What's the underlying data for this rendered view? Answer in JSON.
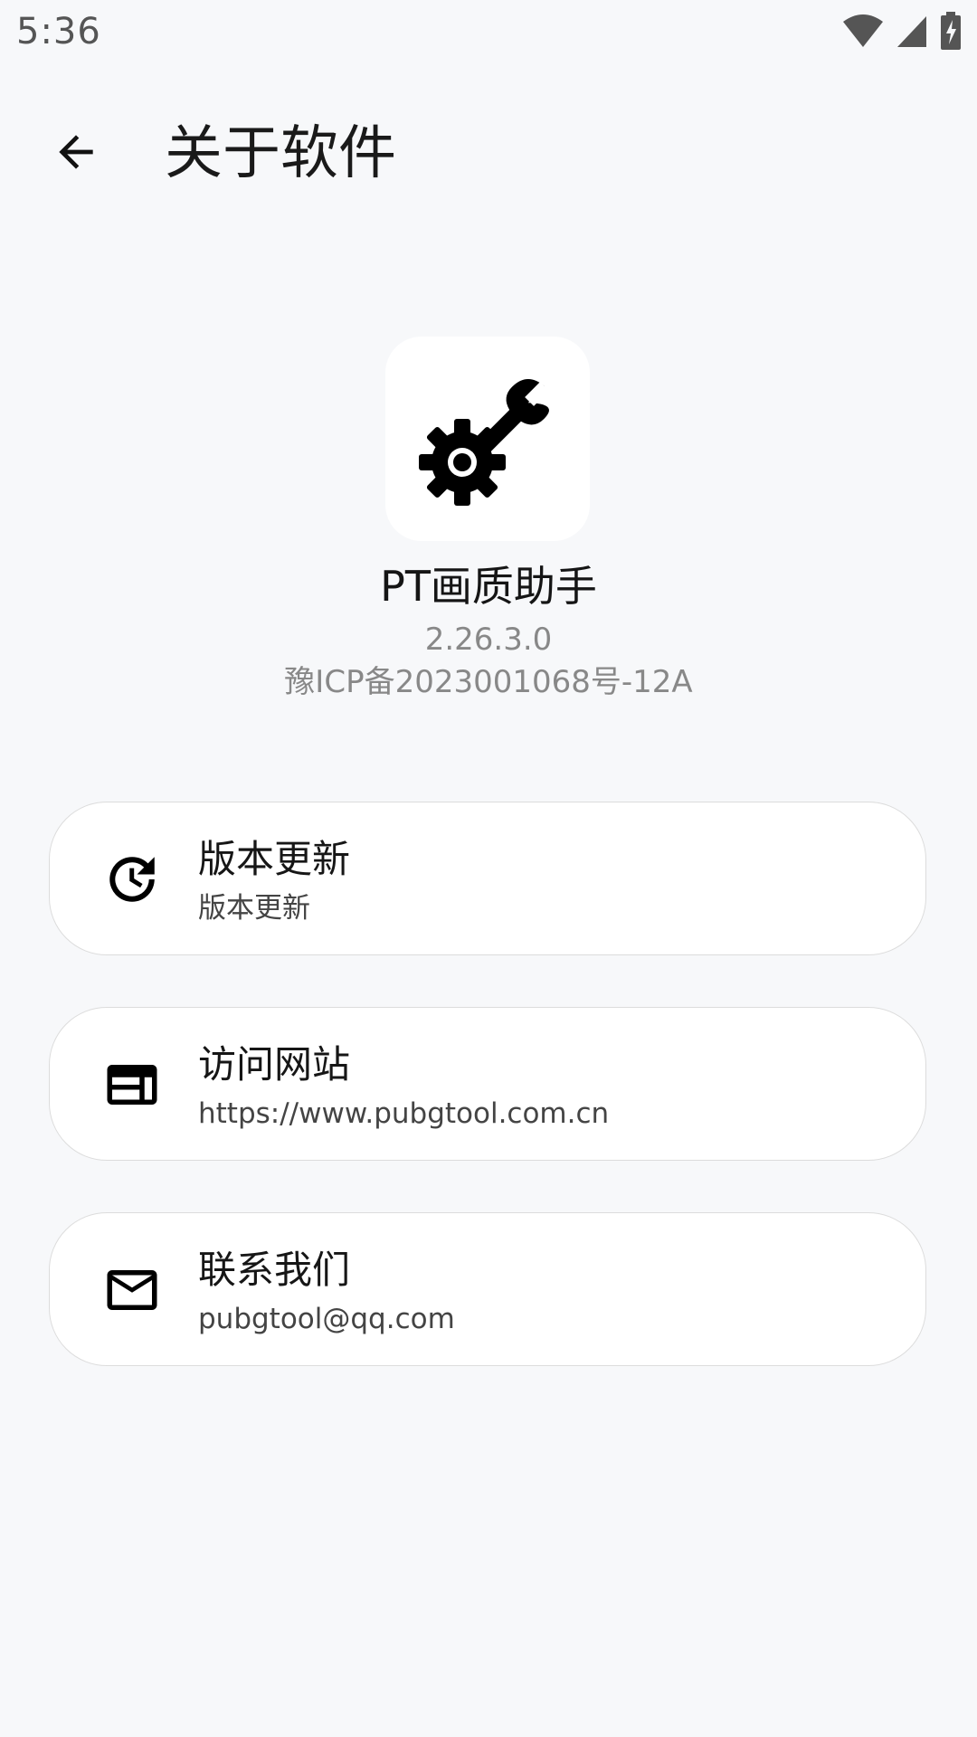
{
  "status_bar": {
    "time": "5:36",
    "icons": [
      "wifi-icon",
      "cell-signal-icon",
      "battery-charging-icon"
    ]
  },
  "app_bar": {
    "back_icon": "arrow-back-icon",
    "title": "关于软件"
  },
  "about": {
    "app_icon": "wrench-gear-icon",
    "app_name": "PT画质助手",
    "version": "2.26.3.0",
    "icp": "豫ICP备2023001068号-12A"
  },
  "items": [
    {
      "icon": "update-history-icon",
      "title": "版本更新",
      "subtitle": "版本更新"
    },
    {
      "icon": "web-browser-icon",
      "title": "访问网站",
      "subtitle": "https://www.pubgtool.com.cn"
    },
    {
      "icon": "mail-icon",
      "title": "联系我们",
      "subtitle": "pubgtool@qq.com"
    }
  ],
  "colors": {
    "background": "#f7f8fa",
    "card": "#ffffff",
    "card_border": "#dcdcdc",
    "secondary_text": "#888888"
  }
}
